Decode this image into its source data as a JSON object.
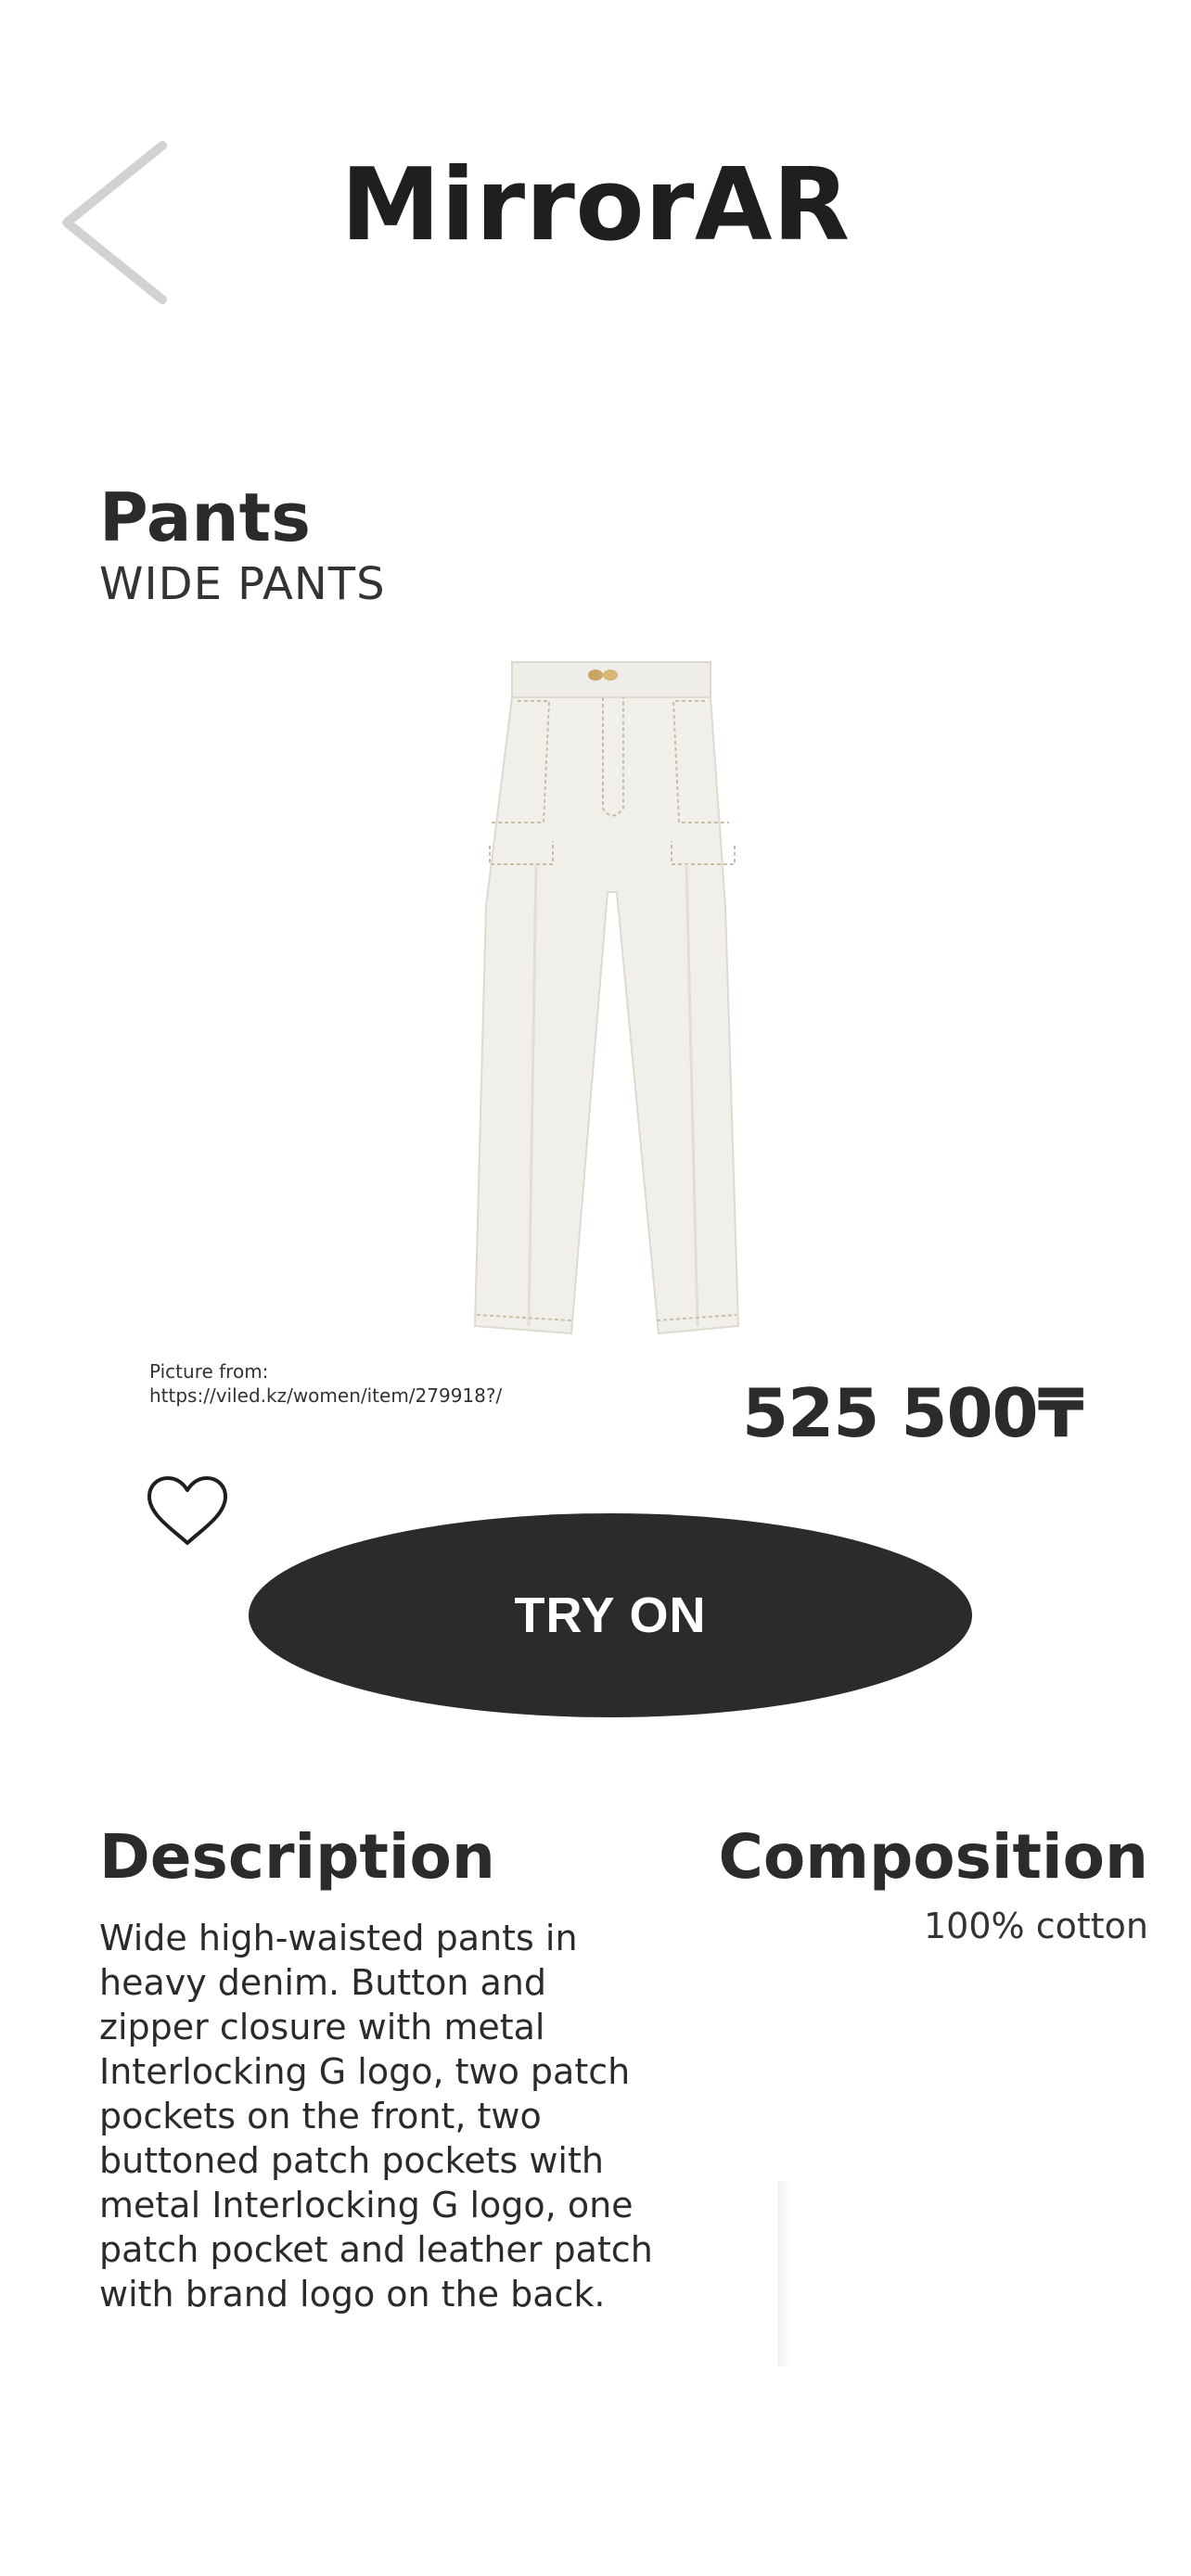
{
  "header": {
    "app_title": "MirrorAR",
    "back_icon": "chevron-left-icon"
  },
  "product": {
    "category": "Pants",
    "name": "WIDE PANTS",
    "image_credit_label": "Picture from:",
    "image_credit_url": "https://viled.kz/women/item/279918?/",
    "price": "525 500₸"
  },
  "actions": {
    "favorite_icon": "heart-outline-icon",
    "try_on_label": "TRY ON"
  },
  "details": {
    "description_title": "Description",
    "description_text": "Wide high-waisted pants in heavy denim. Button and zipper closure with metal Interlocking G logo, two patch pockets on the front, two buttoned patch pockets with metal Interlocking G logo, one patch pocket and leather patch with brand logo on the back.",
    "composition_title": "Composition",
    "composition_text": "100% cotton"
  },
  "colors": {
    "text": "#2b2b2b",
    "button": "#2b2b2b",
    "button_text": "#ffffff",
    "background": "#ffffff"
  }
}
